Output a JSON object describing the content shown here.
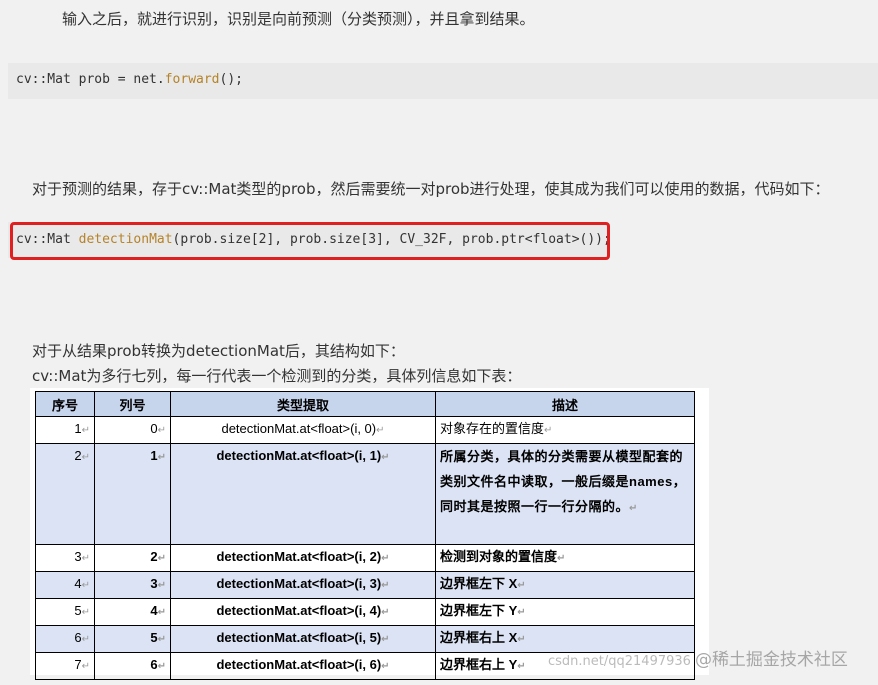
{
  "paragraphs": {
    "p1": "输入之后，就进行识别，识别是向前预测（分类预测），并且拿到结果。",
    "p2": "对于预测的结果，存于cv::Mat类型的prob，然后需要统一对prob进行处理，使其成为我们可以使用的数据，代码如下：",
    "p3": "对于从结果prob转换为detectionMat后，其结构如下：",
    "p4": "cv::Mat为多行七列，每一行代表一个检测到的分类，具体列信息如下表："
  },
  "code": {
    "line1_pre": "cv::Mat prob = net.",
    "line1_fn": "forward",
    "line1_post": "();",
    "line2_pre": "cv::Mat ",
    "line2_fn": "detectionMat",
    "line2_post": "(prob.size[2], prob.size[3], CV_32F, prob.ptr<float>());"
  },
  "table": {
    "headers": [
      "序号",
      "列号",
      "类型提取",
      "描述"
    ],
    "rows": [
      [
        "1",
        "0",
        "detectionMat.at<float>(i, 0)",
        "对象存在的置信度"
      ],
      [
        "2",
        "1",
        "detectionMat.at<float>(i, 1)",
        "所属分类，具体的分类需要从模型配套的类别文件名中读取，一般后缀是names，同时其是按照一行一行分隔的。"
      ],
      [
        "3",
        "2",
        "detectionMat.at<float>(i, 2)",
        "检测到对象的置信度"
      ],
      [
        "4",
        "3",
        "detectionMat.at<float>(i, 3)",
        "边界框左下 X"
      ],
      [
        "5",
        "4",
        "detectionMat.at<float>(i, 4)",
        "边界框左下 Y"
      ],
      [
        "6",
        "5",
        "detectionMat.at<float>(i, 5)",
        "边界框右上 X"
      ],
      [
        "7",
        "6",
        "detectionMat.at<float>(i, 6)",
        "边界框右上 Y"
      ]
    ],
    "return_mark": "↵"
  },
  "watermark": {
    "url": "csdn.net/qq21497936",
    "text": "@稀土掘金技术社区"
  },
  "colors": {
    "highlight_border": "#e02020",
    "header_bg": "#c6d4ec",
    "shaded_row_bg": "#dbe3f4",
    "code_fn": "#b5832a"
  }
}
